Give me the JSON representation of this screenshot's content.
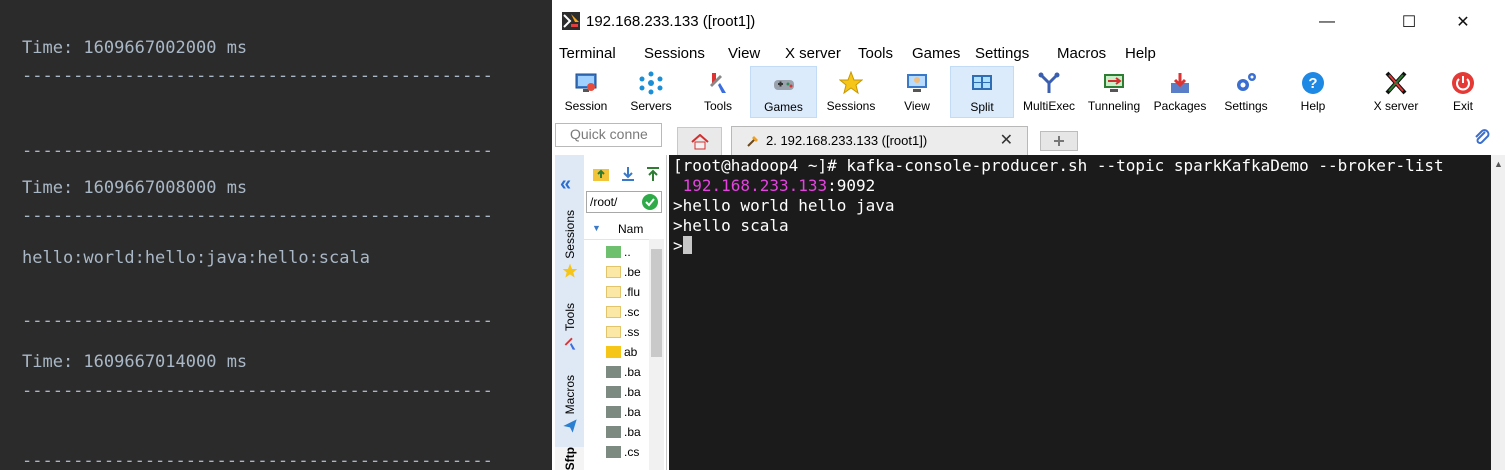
{
  "console": {
    "divider": "----------------------------------------------",
    "lines": [
      "Time: 1609667002000 ms",
      "Time: 1609667008000 ms",
      "hello:world:hello:java:hello:scala",
      "Time: 1609667014000 ms"
    ]
  },
  "window": {
    "title": "192.168.233.133 ([root1])",
    "minimize": "—",
    "maximize": "☐",
    "close": "✕"
  },
  "menu": [
    "Terminal",
    "Sessions",
    "View",
    "X server",
    "Tools",
    "Games",
    "Settings",
    "Macros",
    "Help"
  ],
  "toolbar": [
    {
      "label": "Session",
      "icon": "session-icon"
    },
    {
      "label": "Servers",
      "icon": "servers-icon"
    },
    {
      "label": "Tools",
      "icon": "tools-icon"
    },
    {
      "label": "Games",
      "icon": "games-icon"
    },
    {
      "label": "Sessions",
      "icon": "sessions-star-icon"
    },
    {
      "label": "View",
      "icon": "view-icon"
    },
    {
      "label": "Split",
      "icon": "split-icon"
    },
    {
      "label": "MultiExec",
      "icon": "multiexec-icon"
    },
    {
      "label": "Tunneling",
      "icon": "tunneling-icon"
    },
    {
      "label": "Packages",
      "icon": "packages-icon"
    },
    {
      "label": "Settings",
      "icon": "settings-icon"
    },
    {
      "label": "Help",
      "icon": "help-icon"
    },
    {
      "label": "X server",
      "icon": "xserver-icon"
    },
    {
      "label": "Exit",
      "icon": "exit-icon"
    }
  ],
  "quick_connect": {
    "placeholder": "Quick conne"
  },
  "tabs": {
    "session_label": "2. 192.168.233.133 ([root1])",
    "close": "✕"
  },
  "sidebar": {
    "tabs": [
      "Sessions",
      "Tools",
      "Macros",
      "Sftp"
    ],
    "path": "/root/",
    "column_name": "Nam",
    "files": [
      "..",
      ".be",
      ".flu",
      ".sc",
      ".ss",
      "ab",
      ".ba",
      ".ba",
      ".ba",
      ".ba",
      ".cs"
    ]
  },
  "terminal": {
    "line1": "[root@hadoop4 ~]# kafka-console-producer.sh --topic sparkKafkaDemo --broker-list",
    "line2_ip": " 192.168.233.133",
    "line2_port": ":9092",
    "line3": ">hello world hello java",
    "line4": ">hello scala",
    "line5": ">"
  },
  "colors": {
    "console_bg": "#2b2b2b",
    "terminal_bg": "#1b1b1b",
    "terminal_magenta": "#e443e0",
    "active_tool": "#dcebfb"
  }
}
